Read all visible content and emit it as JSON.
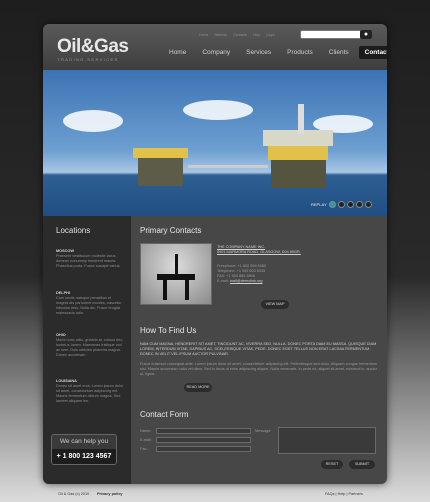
{
  "header": {
    "logo": "Oil&Gas",
    "slogan": "TRADING SERVICES",
    "top_links": [
      "Home",
      "Sitemap",
      "Contacts",
      "Help",
      "Login"
    ],
    "search_placeholder": "",
    "search_icon": "search-icon"
  },
  "nav": [
    {
      "label": "Home"
    },
    {
      "label": "Company"
    },
    {
      "label": "Services"
    },
    {
      "label": "Products"
    },
    {
      "label": "Clients"
    },
    {
      "label": "Contacts",
      "active": true
    }
  ],
  "hero": {
    "replay_label": "REPLAY"
  },
  "sidebar": {
    "title": "Locations",
    "locations": [
      {
        "name": "MOSCOW",
        "text": "Praesent vestibulum molestie lacus. Aenean nonummy hendrerit mauris. Phasellus porta. Fusce suscipit varius."
      },
      {
        "name": "DELPHI",
        "text": "Cum sociis natoque penatibus et magnis dis parturient montes, nascetur ridiculus mus. Nulla dui. Fusce feugiat malesuada odio."
      },
      {
        "name": "OHIO",
        "text": "Morbi nunc odio, gravida at, cursus nec, luctus a, lorem. Maecenas tristique orci ac sem. Duis ultricies pharetra magna. Donec accumsan."
      },
      {
        "name": "LOUISIANA",
        "text": "Donec sit amet eros. Lorem ipsum dolor sit amet, consectetuer adipiscing elit. Mauris fermentum dictum magna. Sed laoreet aliquam leo."
      }
    ],
    "help_label": "We can help you",
    "phone": "+ 1 800 123 4567"
  },
  "primary_contacts": {
    "title": "Primary Contacts",
    "company": "THE COMPANY NAME INC.",
    "address": "8901 MARMORA ROAD, GLASGOW, D04 89GR.",
    "rows": [
      {
        "label": "Freephone:",
        "value": "+1 800 559 6580"
      },
      {
        "label": "Telephone:",
        "value": "+1 959 603 6035"
      },
      {
        "label": "FAX:",
        "value": "+1 504 889 9898"
      }
    ],
    "email_label": "E-mail:",
    "email": "mail@demolink.org",
    "button": "VIEW MAP"
  },
  "find_us": {
    "title": "How To Find Us",
    "bold_text": "NAM CUM MAGNA, HENDRERIT SIT AMET, TINCIDUNT AC, VIVERRA SED, NULLA. DONEC PORTA DIAM EU MASSA. QUISQUE DIAM LOREM, INTERDUM VITAE, DAPIBUS AC, SCELERISQUE VITAE, PEDE. DONEC EGET TELLUS NON ERAT LACINIA FERMENTUM. DONEC IN VELIT VEL IPSUM AUCTOR PULVINAR.",
    "text": "Fusce euismod consequat ante. Lorem ipsum dolor sit amet, consectetuer adipiscing elit. Pellentesque sed dolor. Aliquam congue fermentum nisl. Mauris accumsan nulla vel diam. Sed in lacus ut enim adipiscing aliquet. Nulla venenatis. In pede mi, aliquet sit amet, euismod in, auctor ut, ligula.",
    "button": "READ MORE"
  },
  "contact_form": {
    "title": "Contact Form",
    "name_label": "Name:",
    "email_label": "E-mail:",
    "fax_label": "Fax:",
    "message_label": "Message:",
    "reset": "RESET",
    "submit": "SUBMIT"
  },
  "footer": {
    "copyright": "Oil & Gas (c) 2010",
    "privacy": "Privacy policy",
    "links": "FAQs | Help | Partners"
  }
}
